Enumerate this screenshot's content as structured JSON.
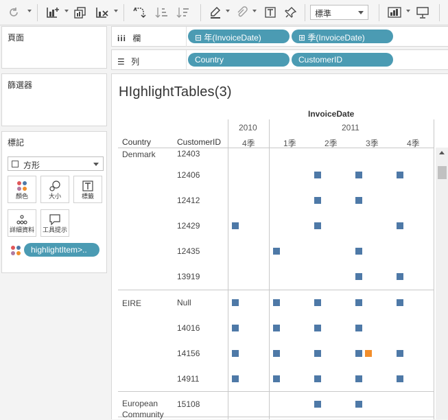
{
  "toolbar": {
    "fit_value": "標準",
    "icons": [
      "undo-icon",
      "add-data-source-icon",
      "new-worksheet-icon",
      "clear-sheet-icon",
      "swap-rows-columns-icon",
      "sort-ascending-icon",
      "sort-descending-icon",
      "highlight-icon",
      "attach-icon",
      "text-label-icon",
      "pin-icon",
      "show-me-icon",
      "presentation-icon"
    ]
  },
  "panels": {
    "pages_title": "頁面",
    "filters_title": "篩選器",
    "marks_title": "標記",
    "mark_type": "方形",
    "mark_buttons": [
      {
        "label": "顏色",
        "icon": "color-icon"
      },
      {
        "label": "大小",
        "icon": "size-icon"
      },
      {
        "label": "標籤",
        "icon": "label-icon"
      },
      {
        "label": "詳細資料",
        "icon": "detail-icon"
      },
      {
        "label": "工具提示",
        "icon": "tooltip-icon"
      }
    ],
    "mark_pill": "highlightItem>.."
  },
  "shelves": {
    "columns_label": "欄",
    "rows_label": "列",
    "column_pills": [
      "年(InvoiceDate)",
      "季(InvoiceDate)"
    ],
    "row_pills": [
      "Country",
      "CustomerID"
    ]
  },
  "view": {
    "title": "HIghlightTables(3)",
    "top_header": "InvoiceDate",
    "col_header_country": "Country",
    "col_header_customer": "CustomerID",
    "years": [
      "2010",
      "2011"
    ],
    "quarters": [
      "4季",
      "1季",
      "2季",
      "3季",
      "4季"
    ],
    "colors": {
      "primary": "#4e79a7",
      "highlight": "#f28e2b"
    },
    "rows": [
      {
        "country": "Denmark",
        "customer": "12403",
        "cells": [
          0,
          0,
          0,
          0,
          0
        ]
      },
      {
        "country": "",
        "customer": "12406",
        "cells": [
          0,
          0,
          1,
          1,
          1
        ]
      },
      {
        "country": "",
        "customer": "12412",
        "cells": [
          0,
          0,
          1,
          1,
          0
        ]
      },
      {
        "country": "",
        "customer": "12429",
        "cells": [
          1,
          0,
          1,
          0,
          1
        ]
      },
      {
        "country": "",
        "customer": "12435",
        "cells": [
          0,
          1,
          0,
          1,
          0
        ]
      },
      {
        "country": "",
        "customer": "13919",
        "cells": [
          0,
          0,
          0,
          1,
          1
        ]
      },
      {
        "country": "EIRE",
        "customer": "Null",
        "cells": [
          1,
          1,
          1,
          1,
          1
        ]
      },
      {
        "country": "",
        "customer": "14016",
        "cells": [
          1,
          1,
          1,
          1,
          0
        ]
      },
      {
        "country": "",
        "customer": "14156",
        "cells": [
          1,
          1,
          1,
          1,
          1
        ],
        "extra_highlight_in_col": 3
      },
      {
        "country": "",
        "customer": "14911",
        "cells": [
          1,
          1,
          1,
          1,
          1
        ]
      },
      {
        "country": "European\nCommunity",
        "customer": "15108",
        "cells": [
          0,
          0,
          1,
          1,
          0
        ]
      }
    ]
  }
}
